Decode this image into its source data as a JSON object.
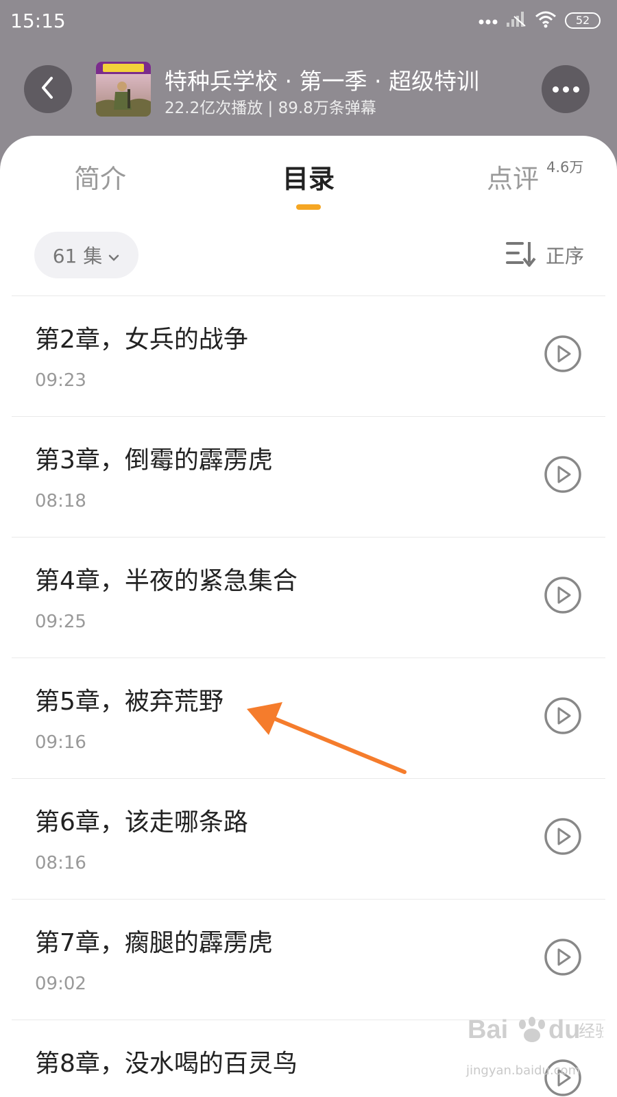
{
  "status_bar": {
    "time": "15:15",
    "battery": "52"
  },
  "header": {
    "title": "特种兵学校 · 第一季 · 超级特训",
    "subtitle": "22.2亿次播放 | 89.8万条弹幕"
  },
  "tabs": [
    {
      "label": "简介",
      "active": false
    },
    {
      "label": "目录",
      "active": true
    },
    {
      "label": "点评",
      "badge": "4.6万",
      "active": false
    }
  ],
  "toolbar": {
    "episode_count": "61 集",
    "sort_label": "正序"
  },
  "episodes": [
    {
      "title": "第2章，女兵的战争",
      "duration": "09:23"
    },
    {
      "title": "第3章，倒霉的霹雳虎",
      "duration": "08:18"
    },
    {
      "title": "第4章，半夜的紧急集合",
      "duration": "09:25"
    },
    {
      "title": "第5章，被弃荒野",
      "duration": "09:16"
    },
    {
      "title": "第6章，该走哪条路",
      "duration": "08:16"
    },
    {
      "title": "第7章，瘸腿的霹雳虎",
      "duration": "09:02"
    },
    {
      "title": "第8章，没水喝的百灵鸟",
      "duration": ""
    }
  ],
  "watermark": {
    "text": "jingyan.baidu.com"
  },
  "colors": {
    "accent": "#f5a623",
    "annotation_arrow": "#f57c2c",
    "header_bg": "#8f8b91"
  }
}
